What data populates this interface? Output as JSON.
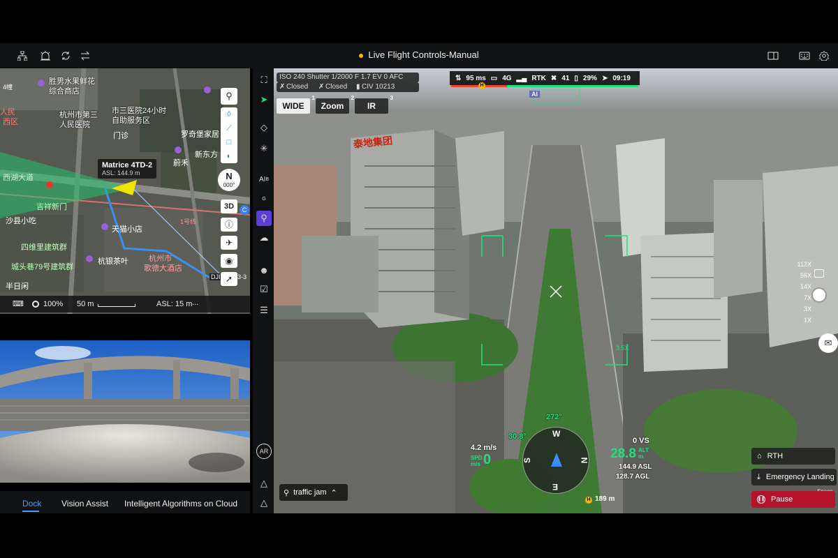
{
  "header": {
    "title": "Live Flight Controls-Manual"
  },
  "topbar_icons": [
    "network-icon",
    "alarm-icon",
    "refresh-route-icon",
    "transfer-icon",
    "layout-icon",
    "keyboard-icon",
    "settings-icon"
  ],
  "map": {
    "labels": {
      "a": "胜男水果鲜花",
      "b": "综合商店",
      "c": "杭州市第三",
      "d": "人民医院",
      "e": "市三医院24小时",
      "f": "自助服务区",
      "g": "门诊",
      "h": "罗奇堡家居",
      "i": "新东方",
      "j": "蔚禾",
      "k": "沙县小吃",
      "l": "天猫小店",
      "m": "杭州市",
      "n": "歌德大酒店",
      "o": "杭银茶叶",
      "p": "半日闲",
      "q": "西湖大道",
      "r": "四维里建筑群",
      "s": "吉祥新门",
      "t": "人民",
      "u": "西区",
      "v": "4幢",
      "w": "1号线",
      "x": "DJI",
      "y": "3-3",
      "z": "城头巷79号建筑群"
    },
    "aircraft_name": "Matrice 4TD-2",
    "aircraft_asl": "ASL: 144.9 m",
    "compass_n": "N",
    "compass_deg": "000°",
    "btn_3d": "3D",
    "badge_c": "C",
    "zoom": "100%",
    "scale": "50 m",
    "asl": "ASL: 15 m",
    "more": "..."
  },
  "bottom_tabs": [
    {
      "label": "Dock"
    },
    {
      "label": "Vision Assist"
    },
    {
      "label": "Intelligent Algorithms on Cloud"
    }
  ],
  "camera": {
    "params": "ISO 240   Shutter 1/2000   F 1.7   EV 0   AFC   AUTO",
    "closed1": "Closed",
    "closed2": "Closed",
    "civ": "CIV 10213",
    "tabs": [
      {
        "label": "WIDE",
        "num": "1"
      },
      {
        "label": "Zoom",
        "num": "2"
      },
      {
        "label": "IR",
        "num": "3"
      }
    ]
  },
  "status": {
    "latency": "95 ms",
    "signal": "4G",
    "rtk": "RTK",
    "sats": "41",
    "battery": "29%",
    "time": "09:19"
  },
  "hud": {
    "ai_tag": "AI",
    "zoom_tag": "3.5X",
    "heading": "272°",
    "pitch": "30.8°",
    "vs": "0 VS",
    "speed_label": "SPD",
    "speed_unit": "m/s",
    "speed": "0",
    "wind": "4.2 m/s",
    "alt": "28.8",
    "alt_label": "ALT",
    "alt_unit": "m",
    "asl": "144.9 ASL",
    "agl": "128.7 AGL",
    "home_dist": "189 m",
    "compass": {
      "n": "N",
      "s": "S",
      "e": "E",
      "w": "W"
    },
    "ai_search": "traffic jam",
    "sign_text": "泰地集团"
  },
  "zoom_levels": [
    "112X",
    "56X",
    "14X",
    "7X",
    "3X",
    "1X"
  ],
  "actions": {
    "rth": "RTH",
    "emergency": "Emergency Landing",
    "space": "Space",
    "pause": "Pause"
  },
  "tool_labels": {
    "ai_b": "AI",
    "b": "B",
    "g": "G",
    "ar": "AR"
  }
}
